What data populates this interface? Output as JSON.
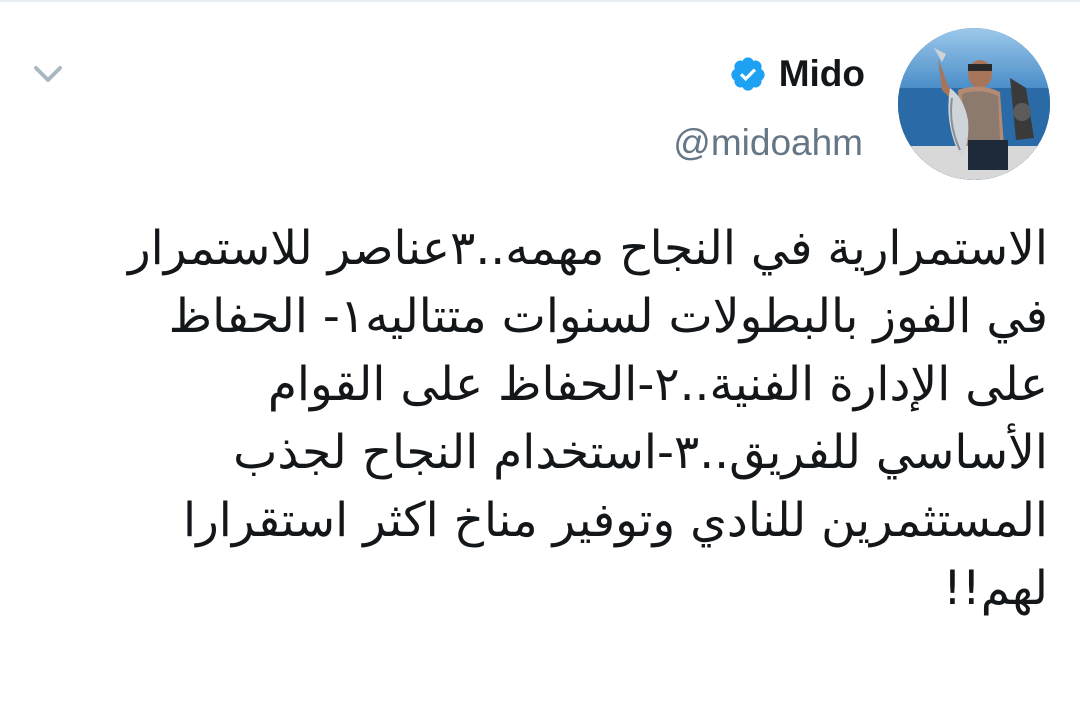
{
  "tweet": {
    "author": {
      "display_name": "Mido",
      "handle": "@midoahm",
      "verified": true,
      "avatar_icon": "profile-photo"
    },
    "menu_icon": "chevron-down-icon",
    "text_lines": [
      "الاستمرارية في النجاح مهمه..٣عناصر للاستمرار",
      "في الفوز بالبطولات لسنوات متتاليه١- الحفاظ",
      "على الإدارة الفنية..٢-الحفاظ على القوام",
      "الأساسي للفريق..٣-استخدام النجاح لجذب",
      "المستثمرين للنادي وتوفير مناخ اكثر استقرارا",
      "لهم!!"
    ]
  },
  "colors": {
    "verified_badge": "#1da1f2",
    "handle_gray": "#657786",
    "chevron_gray": "#aab8c2",
    "text": "#14171a"
  }
}
